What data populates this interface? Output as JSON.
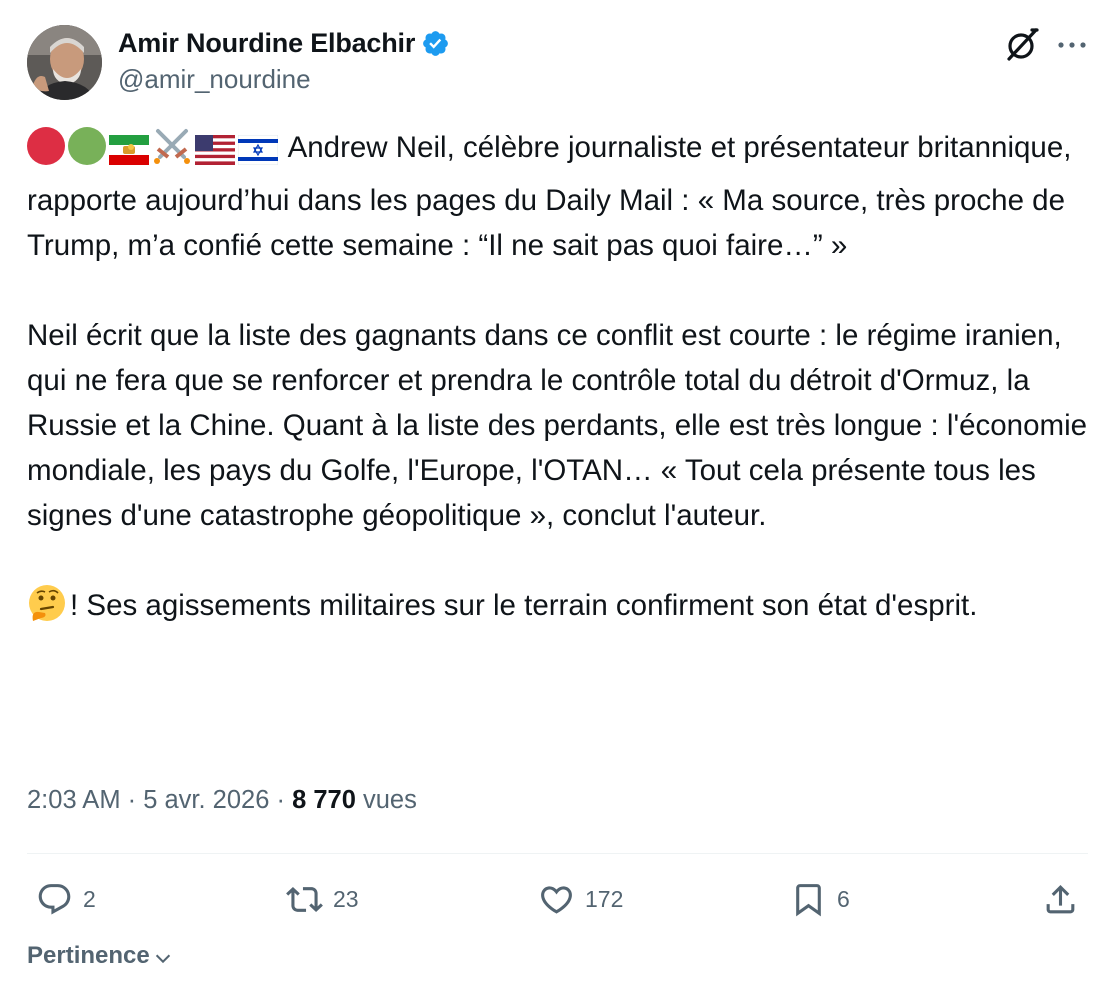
{
  "author": {
    "display_name": "Amir Nourdine Elbachir",
    "handle": "@amir_nourdine",
    "verified": true,
    "verified_color": "#1d9bf0"
  },
  "header_icons": [
    "grok-icon",
    "more-options-icon"
  ],
  "tweet": {
    "lead_emojis": [
      "red-circle",
      "green-circle",
      "iran-lion-sun-flag",
      "crossed-swords",
      "us-flag",
      "israel-flag"
    ],
    "paragraph1": "Andrew Neil, célèbre journaliste et présentateur britannique, rapporte aujourd’hui dans les pages du Daily Mail : « Ma source, très proche de Trump, m’a confié cette semaine : “Il ne sait pas quoi faire…” »",
    "paragraph2": "Neil écrit que la liste des gagnants dans ce conflit est courte : le régime iranien, qui ne fera que se renforcer et prendra le contrôle total du détroit d'Ormuz, la Russie et la Chine. Quant à la liste des perdants, elle est très longue : l'économie mondiale, les pays du Golfe, l'Europe, l'OTAN… « Tout cela présente tous les signes d'une catastrophe géopolitique », conclut l'auteur.",
    "paragraph3_emoji": "thinking-face",
    "paragraph3": "! Ses agissements militaires sur le terrain confirment son état d'esprit."
  },
  "meta": {
    "time": "2:03 AM",
    "separator": " · ",
    "date": "5 avr. 2026",
    "separator2": " · ",
    "views_count": "8 770",
    "views_label": " vues"
  },
  "actions": {
    "replies": "2",
    "reposts": "23",
    "likes": "172",
    "bookmarks": "6"
  },
  "sort": {
    "label": "Pertinence"
  },
  "colors": {
    "text": "#0f1419",
    "secondary": "#536471",
    "divider": "#eff3f4",
    "accent": "#1d9bf0"
  }
}
